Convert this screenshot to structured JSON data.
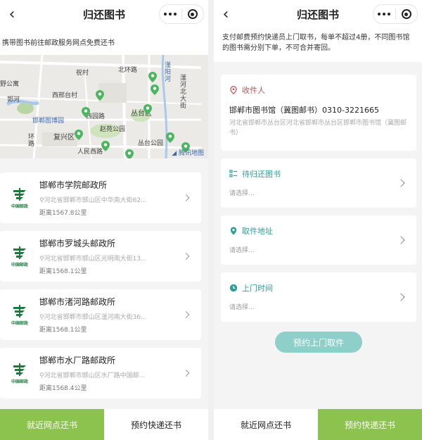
{
  "nav": {
    "title": "归还图书",
    "back": "‹"
  },
  "left": {
    "note": "携带图书前往邮政服务网点免费还书",
    "map": {
      "labels": [
        "祝村",
        "北环路",
        "滏阳河",
        "西邢台村",
        "野公寓",
        "郭河",
        "滏河北大街",
        "邯郸图博园",
        "西园路",
        "丛台区",
        "复兴区",
        "赵苑公园",
        "人民西路",
        "丛台公园",
        "环路"
      ],
      "brand": "腾讯地图"
    },
    "logo_text": "中国邮政",
    "offices": [
      {
        "name": "邯郸市学院邮政所",
        "addr": "河北省邯郸市邯山区中华南大街62...",
        "dist": "距离1567.8公里"
      },
      {
        "name": "邯郸市罗城头邮政所",
        "addr": "河北省邯郸市邯山区光明南大街13...",
        "dist": "距离1568.1公里"
      },
      {
        "name": "邯郸市渚河路邮政所",
        "addr": "河北省邯郸市邯山区滏河南大街36...",
        "dist": "距离1568.1公里"
      },
      {
        "name": "邯郸市水厂路邮政所",
        "addr": "河北省邯郸市邯山区水厂路中国邮...",
        "dist": "距离1568.4公里"
      }
    ]
  },
  "right": {
    "note": "支付邮费预约快递员上门取书，每单不超过4册，不同图书馆的图书需分别下单，不可合并寄回。",
    "receiver": {
      "heading": "收件人",
      "name": "邯郸市图书馆（冀图邮书）0310-3221665",
      "addr": "河北省邯郸市丛台区河北省邯郸市丛台区邯郸市图书馆（冀图邮书）"
    },
    "books": {
      "heading": "待归还图书",
      "placeholder": "请选择..."
    },
    "pickup": {
      "heading": "取件地址",
      "placeholder": "请选择..."
    },
    "time": {
      "heading": "上门时间",
      "placeholder": "请选择..."
    },
    "submit": "预约上门取件"
  },
  "tabs": {
    "nearby": "就近网点还书",
    "express": "预约快递还书"
  },
  "colors": {
    "green": "#8cc34f",
    "teal": "#2c9f9b",
    "red": "#c0555f",
    "button": "#8fcfc9"
  }
}
